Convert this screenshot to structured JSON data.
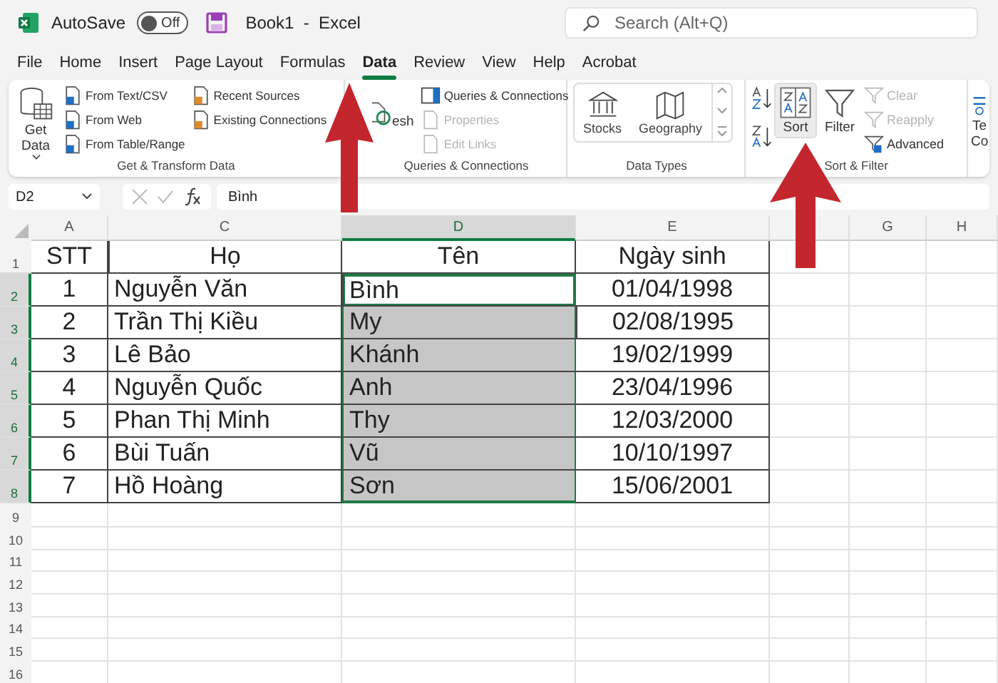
{
  "title_bar": {
    "autosave_label": "AutoSave",
    "autosave_on": false,
    "toggle_text": "Off",
    "document_title": "Book1  -  Excel",
    "search_placeholder": "Search (Alt+Q)"
  },
  "tabs": [
    {
      "label": "File",
      "selected": false
    },
    {
      "label": "Home",
      "selected": false
    },
    {
      "label": "Insert",
      "selected": false
    },
    {
      "label": "Page Layout",
      "selected": false
    },
    {
      "label": "Formulas",
      "selected": false
    },
    {
      "label": "Data",
      "selected": true
    },
    {
      "label": "Review",
      "selected": false
    },
    {
      "label": "View",
      "selected": false
    },
    {
      "label": "Help",
      "selected": false
    },
    {
      "label": "Acrobat",
      "selected": false
    }
  ],
  "ribbon_groups": [
    {
      "label": "Get & Transform Data",
      "columns": [
        [
          {
            "kind": "large",
            "label": "Get Data",
            "dropdown": true,
            "highlighted": false
          }
        ],
        [
          {
            "kind": "small",
            "label": "From Text/CSV",
            "disabled": false
          },
          {
            "kind": "small",
            "label": "From Web",
            "disabled": false
          },
          {
            "kind": "small",
            "label": "From Table/Range",
            "disabled": false
          }
        ],
        [
          {
            "kind": "small",
            "label": "Recent Sources",
            "disabled": false
          },
          {
            "kind": "small",
            "label": "Existing Connections",
            "disabled": false
          }
        ]
      ]
    },
    {
      "label": "Queries & Connections",
      "columns": [
        [
          {
            "kind": "large",
            "label": "esh",
            "dropdown": false,
            "highlighted": false
          }
        ],
        [
          {
            "kind": "small",
            "label": "Queries & Connections",
            "disabled": false
          },
          {
            "kind": "small",
            "label": "Properties",
            "disabled": true
          },
          {
            "kind": "small",
            "label": "Edit Links",
            "disabled": true
          }
        ]
      ]
    },
    {
      "label": "Data Types",
      "columns": [
        [
          {
            "kind": "gallery",
            "tiles": [
              "Stocks",
              "Geography"
            ]
          }
        ]
      ]
    },
    {
      "label": "Sort & Filter",
      "columns": [
        [
          {
            "kind": "icon"
          },
          {
            "kind": "icon"
          }
        ],
        [
          {
            "kind": "large",
            "label": "Sort",
            "dropdown": false,
            "highlighted": true
          }
        ],
        [
          {
            "kind": "large",
            "label": "Filter",
            "dropdown": false,
            "highlighted": false
          }
        ],
        [
          {
            "kind": "small",
            "label": "Clear",
            "disabled": true
          },
          {
            "kind": "small",
            "label": "Reapply",
            "disabled": true
          },
          {
            "kind": "small",
            "label": "Advanced",
            "disabled": false
          }
        ]
      ]
    },
    {
      "columns": [
        [
          {
            "kind": "large",
            "label": "Te Co",
            "dropdown": false,
            "highlighted": false
          }
        ]
      ]
    }
  ],
  "formula_bar": {
    "name_box": "D2",
    "content": "Bình"
  },
  "columns": [
    {
      "label": "A",
      "selected": false
    },
    {
      "label": "C",
      "selected": false
    },
    {
      "label": "D",
      "selected": true
    },
    {
      "label": "E",
      "selected": false
    },
    {
      "selected": false
    },
    {
      "label": "G",
      "selected": false
    },
    {
      "label": "H",
      "selected": false
    }
  ],
  "rows": [
    {
      "number": "1",
      "selected": false,
      "active": false,
      "cells": [
        "STT",
        "Họ",
        "Tên",
        "Ngày sinh"
      ]
    },
    {
      "number": "2",
      "selected": true,
      "active": true,
      "cells": [
        "1",
        "Nguyễn Văn",
        "Bình",
        "01/04/1998"
      ]
    },
    {
      "number": "3",
      "selected": true,
      "active": false,
      "cells": [
        "2",
        "Trần Thị Kiều",
        "My",
        "02/08/1995"
      ]
    },
    {
      "number": "4",
      "selected": true,
      "active": false,
      "cells": [
        "3",
        "Lê Bảo",
        "Khánh",
        "19/02/1999"
      ]
    },
    {
      "number": "5",
      "selected": true,
      "active": false,
      "cells": [
        "4",
        "Nguyễn Quốc",
        "Anh",
        "23/04/1996"
      ]
    },
    {
      "number": "6",
      "selected": true,
      "active": false,
      "cells": [
        "5",
        "Phan Thị Minh",
        "Thy",
        "12/03/2000"
      ]
    },
    {
      "number": "7",
      "selected": true,
      "active": false,
      "cells": [
        "6",
        "Bùi Tuấn",
        "Vũ",
        "10/10/1997"
      ]
    },
    {
      "number": "8",
      "selected": true,
      "active": false,
      "cells": [
        "7",
        "Hồ Hoàng",
        "Sơn",
        "15/06/2001"
      ]
    },
    {
      "number": "9",
      "selected": false,
      "active": false,
      "cells": []
    },
    {
      "number": "10",
      "selected": false,
      "active": false,
      "cells": []
    },
    {
      "number": "11",
      "selected": false,
      "active": false,
      "cells": []
    },
    {
      "number": "12",
      "selected": false,
      "active": false,
      "cells": []
    },
    {
      "number": "13",
      "selected": false,
      "active": false,
      "cells": []
    },
    {
      "number": "14",
      "selected": false,
      "active": false,
      "cells": []
    },
    {
      "number": "15",
      "selected": false,
      "active": false,
      "cells": []
    },
    {
      "number": "16",
      "selected": false,
      "active": false,
      "cells": []
    }
  ]
}
